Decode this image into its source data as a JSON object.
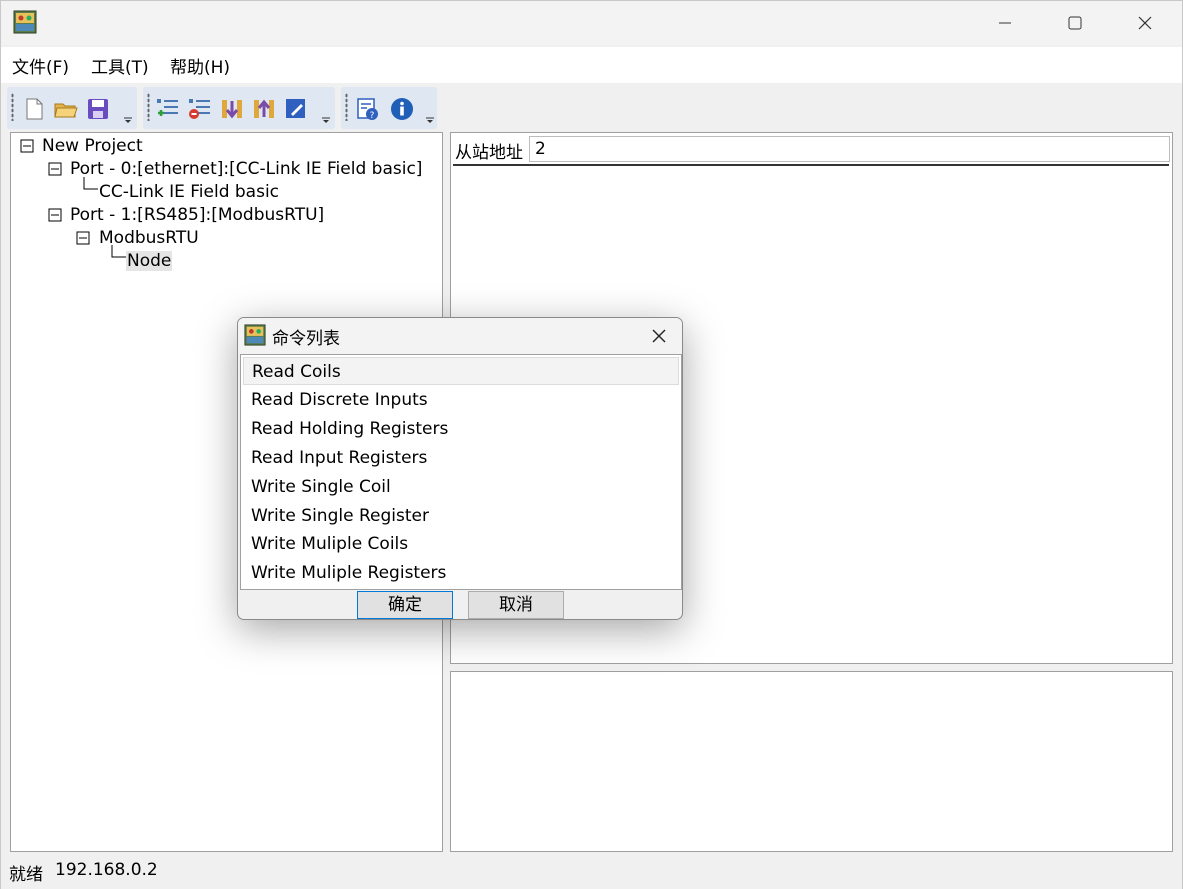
{
  "menu": {
    "file": "文件(F)",
    "tools": "工具(T)",
    "help": "帮助(H)"
  },
  "toolbar": {
    "group1": [
      "new-file-icon",
      "open-folder-icon",
      "save-icon"
    ],
    "group2": [
      "add-port-icon",
      "delete-node-icon",
      "download-icon",
      "upload-icon",
      "edit-icon"
    ],
    "group3": [
      "help-document-icon",
      "info-icon"
    ]
  },
  "tree": {
    "root": "New Project",
    "port0": "Port - 0:[ethernet]:[CC-Link IE Field basic]",
    "port0_child": "CC-Link IE Field basic",
    "port1": "Port - 1:[RS485]:[ModbusRTU]",
    "port1_child": "ModbusRTU",
    "node": "Node"
  },
  "detail": {
    "slave_address_label": "从站地址",
    "slave_address_value": "2"
  },
  "status": {
    "state": "就绪",
    "ip": "192.168.0.2"
  },
  "dialog": {
    "title": "命令列表",
    "items": [
      "Read Coils",
      "Read Discrete Inputs",
      "Read Holding Registers",
      "Read Input Registers",
      "Write Single Coil",
      "Write Single Register",
      "Write Muliple Coils",
      "Write Muliple Registers"
    ],
    "selected_index": 0,
    "ok_label": "确定",
    "cancel_label": "取消"
  },
  "colors": {
    "accent": "#0078d7",
    "panel_border": "#a0a0a0",
    "toolbar_group": "#dfe7f2",
    "selection": "#e5e5e5"
  }
}
